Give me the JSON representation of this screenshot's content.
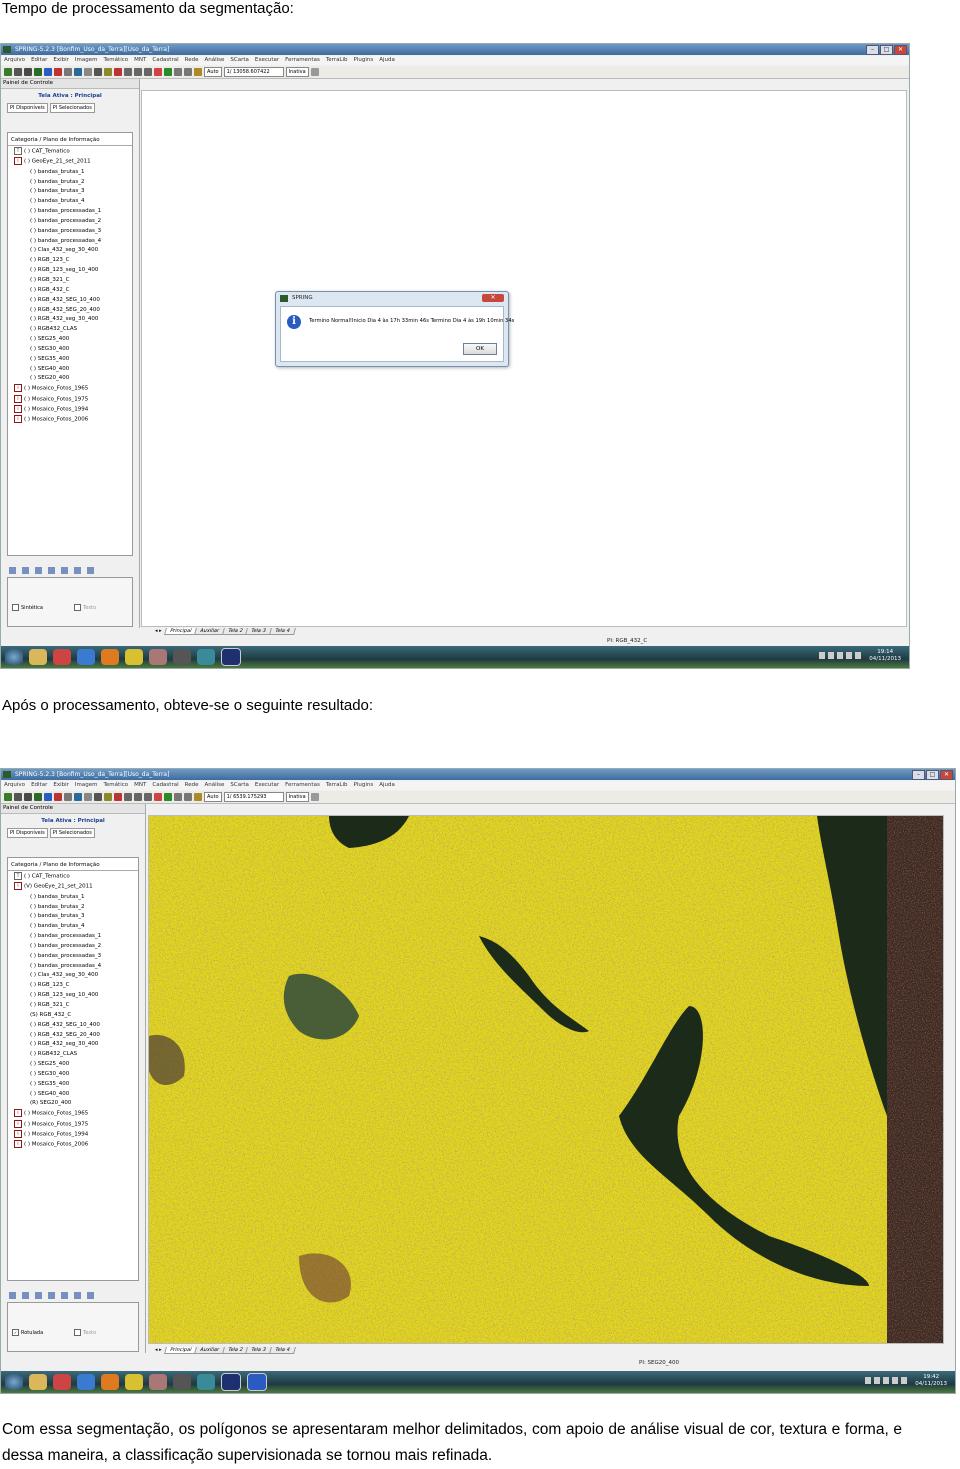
{
  "captions": {
    "first": "Tempo de processamento da segmentação:",
    "second": "Após o processamento, obteve-se o seguinte resultado:",
    "paragraph": "Com essa segmentação, os polígonos se apresentaram melhor delimitados, com apoio de análise visual de cor, textura e forma, e dessa maneira, a classificação supervisionada se tornou mais refinada."
  },
  "shot1": {
    "title": "SPRING-5.2.3 [Bonfim_Uso_da_Terra][Uso_da_Terra]",
    "menus": [
      "Arquivo",
      "Editar",
      "Exibir",
      "Imagem",
      "Temático",
      "MNT",
      "Cadastral",
      "Rede",
      "Análise",
      "SCarta",
      "Executar",
      "Ferramentas",
      "TerraLib",
      "Plugins",
      "Ajuda"
    ],
    "zoom_mode": "Auto",
    "scale": "1/ 13058.607422",
    "state": "Inativa",
    "panel_title": "Painel de Controle",
    "active_screen": "Tela Ativa : Principal",
    "tab_available": "PI Disponíveis",
    "tab_selected": "PI Selecionados",
    "tree_header": "Categoria / Plano de Informação",
    "check_left": "Sintética",
    "check_right": "Texto",
    "status": "PI: RGB_432_C",
    "clock_time": "19:14",
    "clock_date": "04/11/2013",
    "dialog": {
      "title": "SPRING",
      "close": "✕",
      "message": "Termino Normal!Inicio Dia 4 às 17h 33min 46s Termino Dia 4 às 19h 10min 34s",
      "ok": "OK"
    }
  },
  "shot2": {
    "title": "SPRING-5.2.3 [Bonfim_Uso_da_Terra][Uso_da_Terra]",
    "menus": [
      "Arquivo",
      "Editar",
      "Exibir",
      "Imagem",
      "Temático",
      "MNT",
      "Cadastral",
      "Rede",
      "Análise",
      "SCarta",
      "Executar",
      "Ferramentas",
      "TerraLib",
      "Plugins",
      "Ajuda"
    ],
    "zoom_mode": "Auto",
    "scale": "1/ 6539.175293",
    "state": "Inativa",
    "panel_title": "Painel de Controle",
    "active_screen": "Tela Ativa : Principal",
    "tab_available": "PI Disponíveis",
    "tab_selected": "PI Selecionados",
    "tree_header": "Categoria / Plano de Informação",
    "check_left": "Rotulada",
    "check_right": "Texto",
    "status": "PI: SEG20_400",
    "clock_time": "19:42",
    "clock_date": "04/11/2013"
  },
  "bottom_tabs": [
    "Principal",
    "Auxiliar",
    "Tela 2",
    "Tela 3",
    "Tela 4"
  ],
  "tree1": {
    "top_before": [
      {
        "icon": "T",
        "label": "( ) CAT_Tematico"
      },
      {
        "icon": "I",
        "label": "( ) GeoEye_21_set_2011"
      }
    ],
    "children": [
      "( ) bandas_brutas_1",
      "( ) bandas_brutas_2",
      "( ) bandas_brutas_3",
      "( ) bandas_brutas_4",
      "( ) bandas_processadas_1",
      "( ) bandas_processadas_2",
      "( ) bandas_processadas_3",
      "( ) bandas_processadas_4",
      "( ) Clas_432_seg_30_400",
      "( ) RGB_123_C",
      "( ) RGB_123_seg_10_400",
      "( ) RGB_321_C",
      "( ) RGB_432_C",
      "( ) RGB_432_SEG_10_400",
      "( ) RGB_432_SEG_20_400",
      "( ) RGB_432_seg_30_400",
      "( ) RGB432_CLAS",
      "( ) SEG25_400",
      "( ) SEG30_400",
      "( ) SEG35_400",
      "( ) SEG40_400",
      "( ) SEG20_400"
    ],
    "top_after": [
      {
        "icon": "I",
        "label": "( ) Mosaico_Fotos_1965"
      },
      {
        "icon": "I",
        "label": "( ) Mosaico_Fotos_1975"
      },
      {
        "icon": "I",
        "label": "( ) Mosaico_Fotos_1994"
      },
      {
        "icon": "I",
        "label": "( ) Mosaico_Fotos_2006"
      }
    ]
  },
  "tree2": {
    "top_before": [
      {
        "icon": "T",
        "label": "( ) CAT_Tematico"
      },
      {
        "icon": "I",
        "label": "(V) GeoEye_21_set_2011"
      }
    ],
    "children": [
      "( ) bandas_brutas_1",
      "( ) bandas_brutas_2",
      "( ) bandas_brutas_3",
      "( ) bandas_brutas_4",
      "( ) bandas_processadas_1",
      "( ) bandas_processadas_2",
      "( ) bandas_processadas_3",
      "( ) bandas_processadas_4",
      "( ) Clas_432_seg_30_400",
      "( ) RGB_123_C",
      "( ) RGB_123_seg_10_400",
      "( ) RGB_321_C",
      "(S) RGB_432_C",
      "( ) RGB_432_SEG_10_400",
      "( ) RGB_432_SEG_20_400",
      "( ) RGB_432_seg_30_400",
      "( ) RGB432_CLAS",
      "( ) SEG25_400",
      "( ) SEG30_400",
      "( ) SEG35_400",
      "( ) SEG40_400",
      "(R) SEG20_400"
    ],
    "top_after": [
      {
        "icon": "I",
        "label": "( ) Mosaico_Fotos_1965"
      },
      {
        "icon": "I",
        "label": "( ) Mosaico_Fotos_1975"
      },
      {
        "icon": "I",
        "label": "( ) Mosaico_Fotos_1994"
      },
      {
        "icon": "I",
        "label": "( ) Mosaico_Fotos_2006"
      }
    ]
  },
  "colors": {
    "segment_yellow": "#e8e010",
    "water_dark": "#1c2a1a",
    "vegetation_red": "#b83a32",
    "taskbar": "#1e3a42"
  }
}
